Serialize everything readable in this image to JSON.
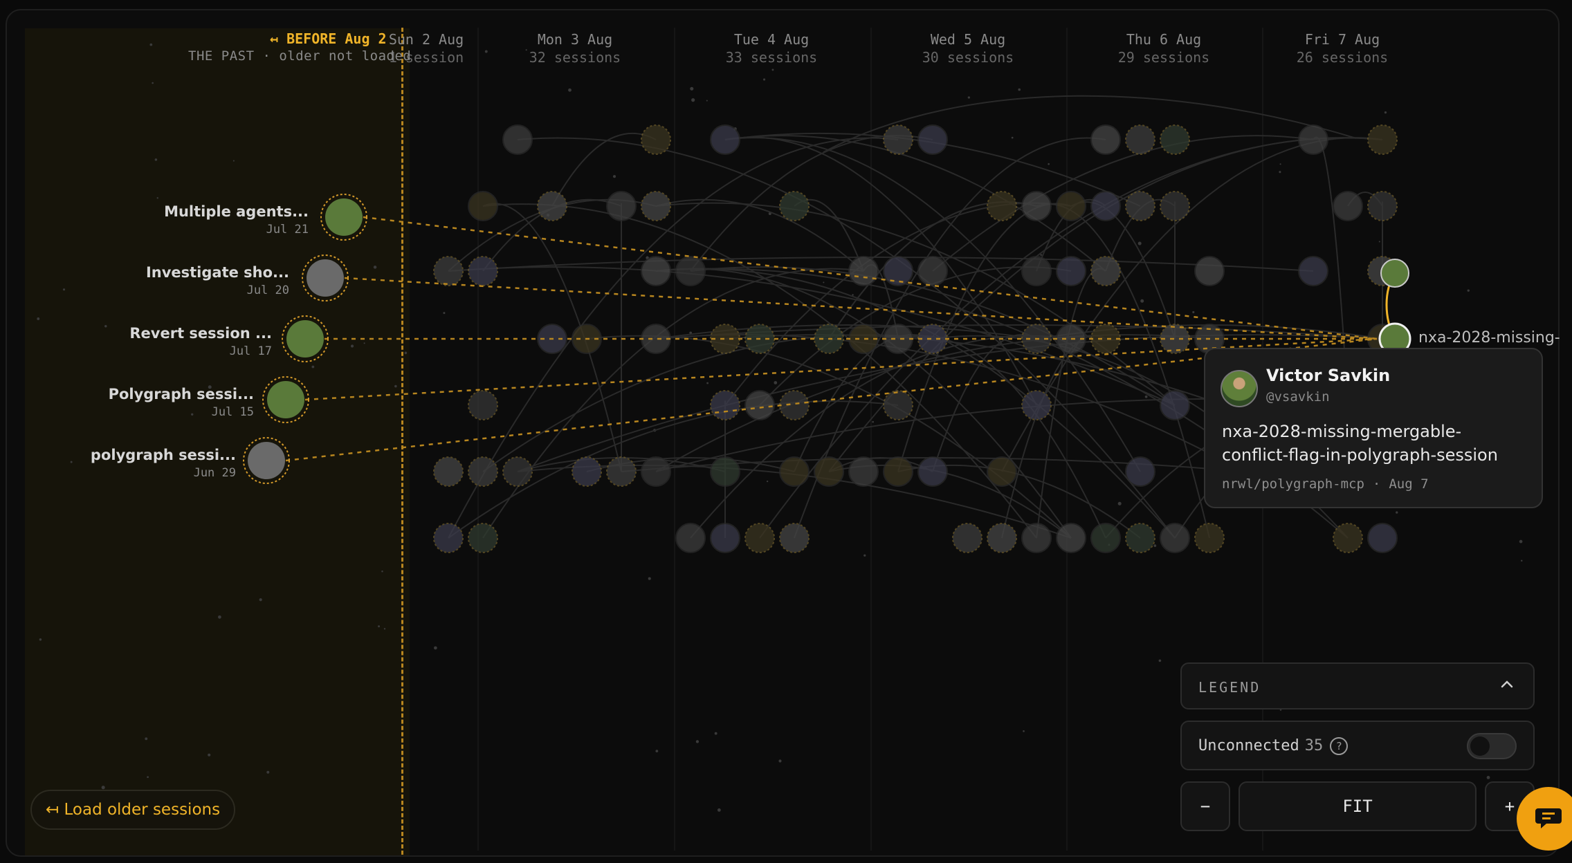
{
  "past": {
    "title": "↤ BEFORE Aug 2",
    "subtitle": "THE PAST · older not loaded",
    "items": [
      {
        "title": "Multiple agents...",
        "date": "Jul 21"
      },
      {
        "title": "Investigate sho...",
        "date": "Jul 20"
      },
      {
        "title": "Revert session ...",
        "date": "Jul 17"
      },
      {
        "title": "Polygraph sessi...",
        "date": "Jul 15"
      },
      {
        "title": "polygraph sessi...",
        "date": "Jun 29"
      }
    ],
    "load_older_label": "↤ Load older sessions"
  },
  "days": [
    {
      "label": "Sun 2 Aug",
      "count": "1 session"
    },
    {
      "label": "Mon 3 Aug",
      "count": "32 sessions"
    },
    {
      "label": "Tue 4 Aug",
      "count": "33 sessions"
    },
    {
      "label": "Wed 5 Aug",
      "count": "30 sessions"
    },
    {
      "label": "Thu 6 Aug",
      "count": "29 sessions"
    },
    {
      "label": "Fri 7 Aug",
      "count": "26 sessions"
    }
  ],
  "selected_node": {
    "label": "nxa-2028-missing-"
  },
  "tooltip": {
    "name": "Victor Savkin",
    "handle": "@vsavkin",
    "title": "nxa-2028-missing-mergable-conflict-flag-in-polygraph-session",
    "repo": "nrwl/polygraph-mcp",
    "separator": "·",
    "date": "Aug 7"
  },
  "legend": {
    "label": "LEGEND",
    "chevron_icon": "chevron-up-icon"
  },
  "unconnected": {
    "label": "Unconnected",
    "count": "35",
    "help": "?",
    "toggle_on": false
  },
  "zoom": {
    "minus": "−",
    "fit": "FIT",
    "plus": "+"
  },
  "colors": {
    "accent": "#f0b429",
    "background": "#0a0a0a"
  }
}
